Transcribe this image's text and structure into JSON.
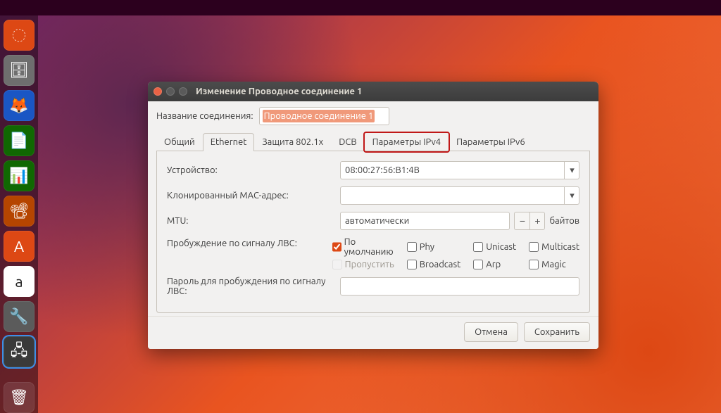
{
  "window": {
    "title": "Изменение Проводное соединение 1",
    "connection_name_label": "Название соединения:",
    "connection_name_value": "Проводное соединение 1"
  },
  "tabs": {
    "general": "Общий",
    "ethernet": "Ethernet",
    "security": "Защита 802.1x",
    "dcb": "DCB",
    "ipv4": "Параметры IPv4",
    "ipv6": "Параметры IPv6",
    "active": "ethernet",
    "highlighted": "ipv4"
  },
  "ethernet": {
    "device_label": "Устройство:",
    "device_value": "08:00:27:56:B1:4B",
    "cloned_mac_label": "Клонированный MAC-адрес:",
    "cloned_mac_value": "",
    "mtu_label": "MTU:",
    "mtu_value": "автоматически",
    "mtu_unit": "байтов",
    "wol_label": "Пробуждение по сигналу ЛВС:",
    "wol_password_label": "Пароль для пробуждения по сигналу ЛВС:",
    "wol_password_value": "",
    "wol_options": {
      "default": {
        "label": "По умолчанию",
        "checked": true,
        "disabled": false
      },
      "phy": {
        "label": "Phy",
        "checked": false,
        "disabled": false
      },
      "unicast": {
        "label": "Unicast",
        "checked": false,
        "disabled": false
      },
      "multicast": {
        "label": "Multicast",
        "checked": false,
        "disabled": false
      },
      "ignore": {
        "label": "Пропустить",
        "checked": false,
        "disabled": true
      },
      "broadcast": {
        "label": "Broadcast",
        "checked": false,
        "disabled": false
      },
      "arp": {
        "label": "Arp",
        "checked": false,
        "disabled": false
      },
      "magic": {
        "label": "Magic",
        "checked": false,
        "disabled": false
      }
    }
  },
  "buttons": {
    "cancel": "Отмена",
    "save": "Сохранить"
  },
  "launcher": {
    "items": [
      {
        "name": "ubuntu-dash",
        "glyph": "◌"
      },
      {
        "name": "files",
        "glyph": "🗄"
      },
      {
        "name": "firefox",
        "glyph": "🦊"
      },
      {
        "name": "writer",
        "glyph": "📄"
      },
      {
        "name": "calc",
        "glyph": "📊"
      },
      {
        "name": "impress",
        "glyph": "📽"
      },
      {
        "name": "software",
        "glyph": "A"
      },
      {
        "name": "amazon",
        "glyph": "a"
      },
      {
        "name": "settings",
        "glyph": "🔧"
      },
      {
        "name": "network",
        "glyph": "🖧"
      }
    ],
    "trash_glyph": "🗑"
  }
}
